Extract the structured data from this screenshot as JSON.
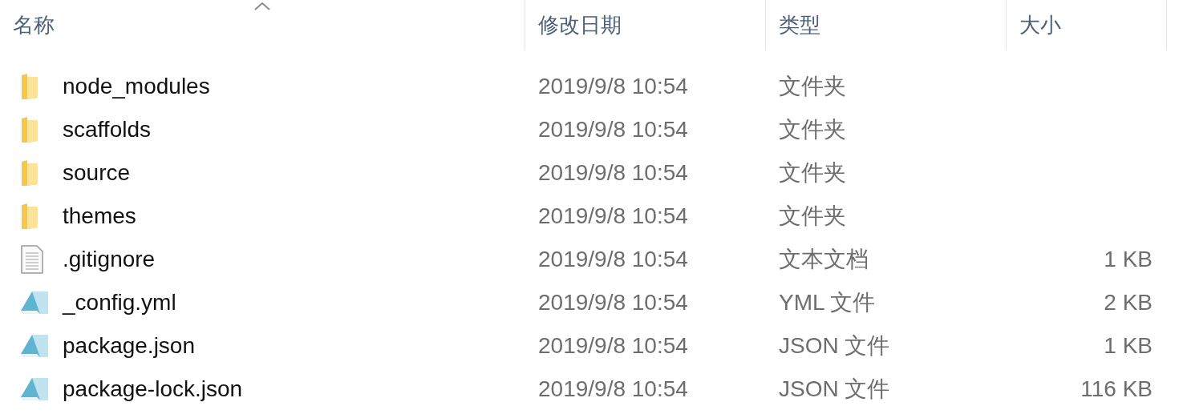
{
  "columns": [
    {
      "label": "名称",
      "sorted": true
    },
    {
      "label": "修改日期",
      "sorted": false
    },
    {
      "label": "类型",
      "sorted": false
    },
    {
      "label": "大小",
      "sorted": false
    }
  ],
  "rows": [
    {
      "kind": "folder",
      "name": "node_modules",
      "modified": "2019/9/8 10:54",
      "type": "文件夹"
    },
    {
      "kind": "folder",
      "name": "scaffolds",
      "modified": "2019/9/8 10:54",
      "type": "文件夹"
    },
    {
      "kind": "folder",
      "name": "source",
      "modified": "2019/9/8 10:54",
      "type": "文件夹"
    },
    {
      "kind": "folder",
      "name": "themes",
      "modified": "2019/9/8 10:54",
      "type": "文件夹"
    },
    {
      "kind": "text",
      "name": ".gitignore",
      "modified": "2019/9/8 10:54",
      "type": "文本文档",
      "size": "1 KB"
    },
    {
      "kind": "script",
      "name": "_config.yml",
      "modified": "2019/9/8 10:54",
      "type": "YML 文件",
      "size": "2 KB"
    },
    {
      "kind": "script",
      "name": "package.json",
      "modified": "2019/9/8 10:54",
      "type": "JSON 文件",
      "size": "1 KB"
    },
    {
      "kind": "script",
      "name": "package-lock.json",
      "modified": "2019/9/8 10:54",
      "type": "JSON 文件",
      "size": "116 KB"
    }
  ]
}
